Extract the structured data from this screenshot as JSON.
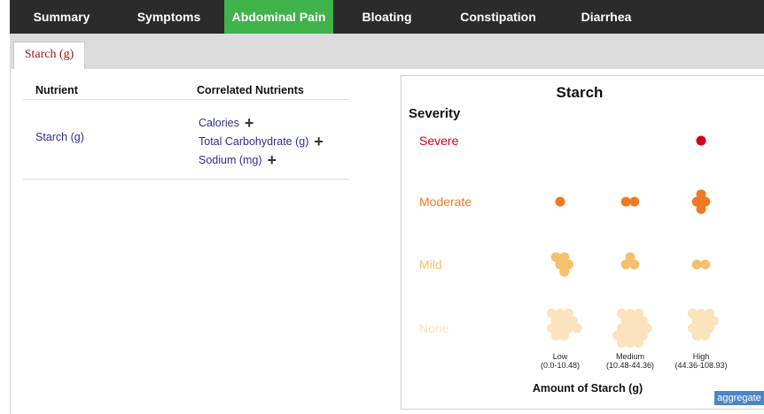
{
  "nav": {
    "tabs": [
      {
        "label": "Summary",
        "active": false
      },
      {
        "label": "Symptoms",
        "active": false
      },
      {
        "label": "Abdominal Pain",
        "active": true
      },
      {
        "label": "Bloating",
        "active": false
      },
      {
        "label": "Constipation",
        "active": false
      },
      {
        "label": "Diarrhea",
        "active": false
      }
    ]
  },
  "subtab": {
    "label": "Starch (g)"
  },
  "table": {
    "headers": {
      "nutrient": "Nutrient",
      "correlated": "Correlated Nutrients"
    },
    "nutrient": "Starch (g)",
    "correlated": [
      "Calories",
      "Total Carbohydrate (g)",
      "Sodium (mg)"
    ],
    "add_glyph": "+"
  },
  "chart_data": {
    "type": "scatter",
    "title": "Starch",
    "ylabel": "Severity",
    "xlabel": "Amount of Starch (g)",
    "severity_levels": [
      "None",
      "Mild",
      "Moderate",
      "Severe"
    ],
    "severity_colors": {
      "Severe": "#d0021b",
      "Moderate": "#f07a22",
      "Mild": "#f5c06e",
      "None": "#fbe3bd"
    },
    "amount_bins": [
      {
        "label": "Low",
        "range": "(0.0-10.48)"
      },
      {
        "label": "Medium",
        "range": "(10.48-44.36)"
      },
      {
        "label": "High",
        "range": "(44.36-108.93)"
      }
    ],
    "counts": {
      "Severe": [
        0,
        0,
        1
      ],
      "Moderate": [
        1,
        2,
        4
      ],
      "Mild": [
        5,
        3,
        2
      ],
      "None": [
        12,
        17,
        11
      ]
    }
  },
  "aggregate_button": "aggregate"
}
